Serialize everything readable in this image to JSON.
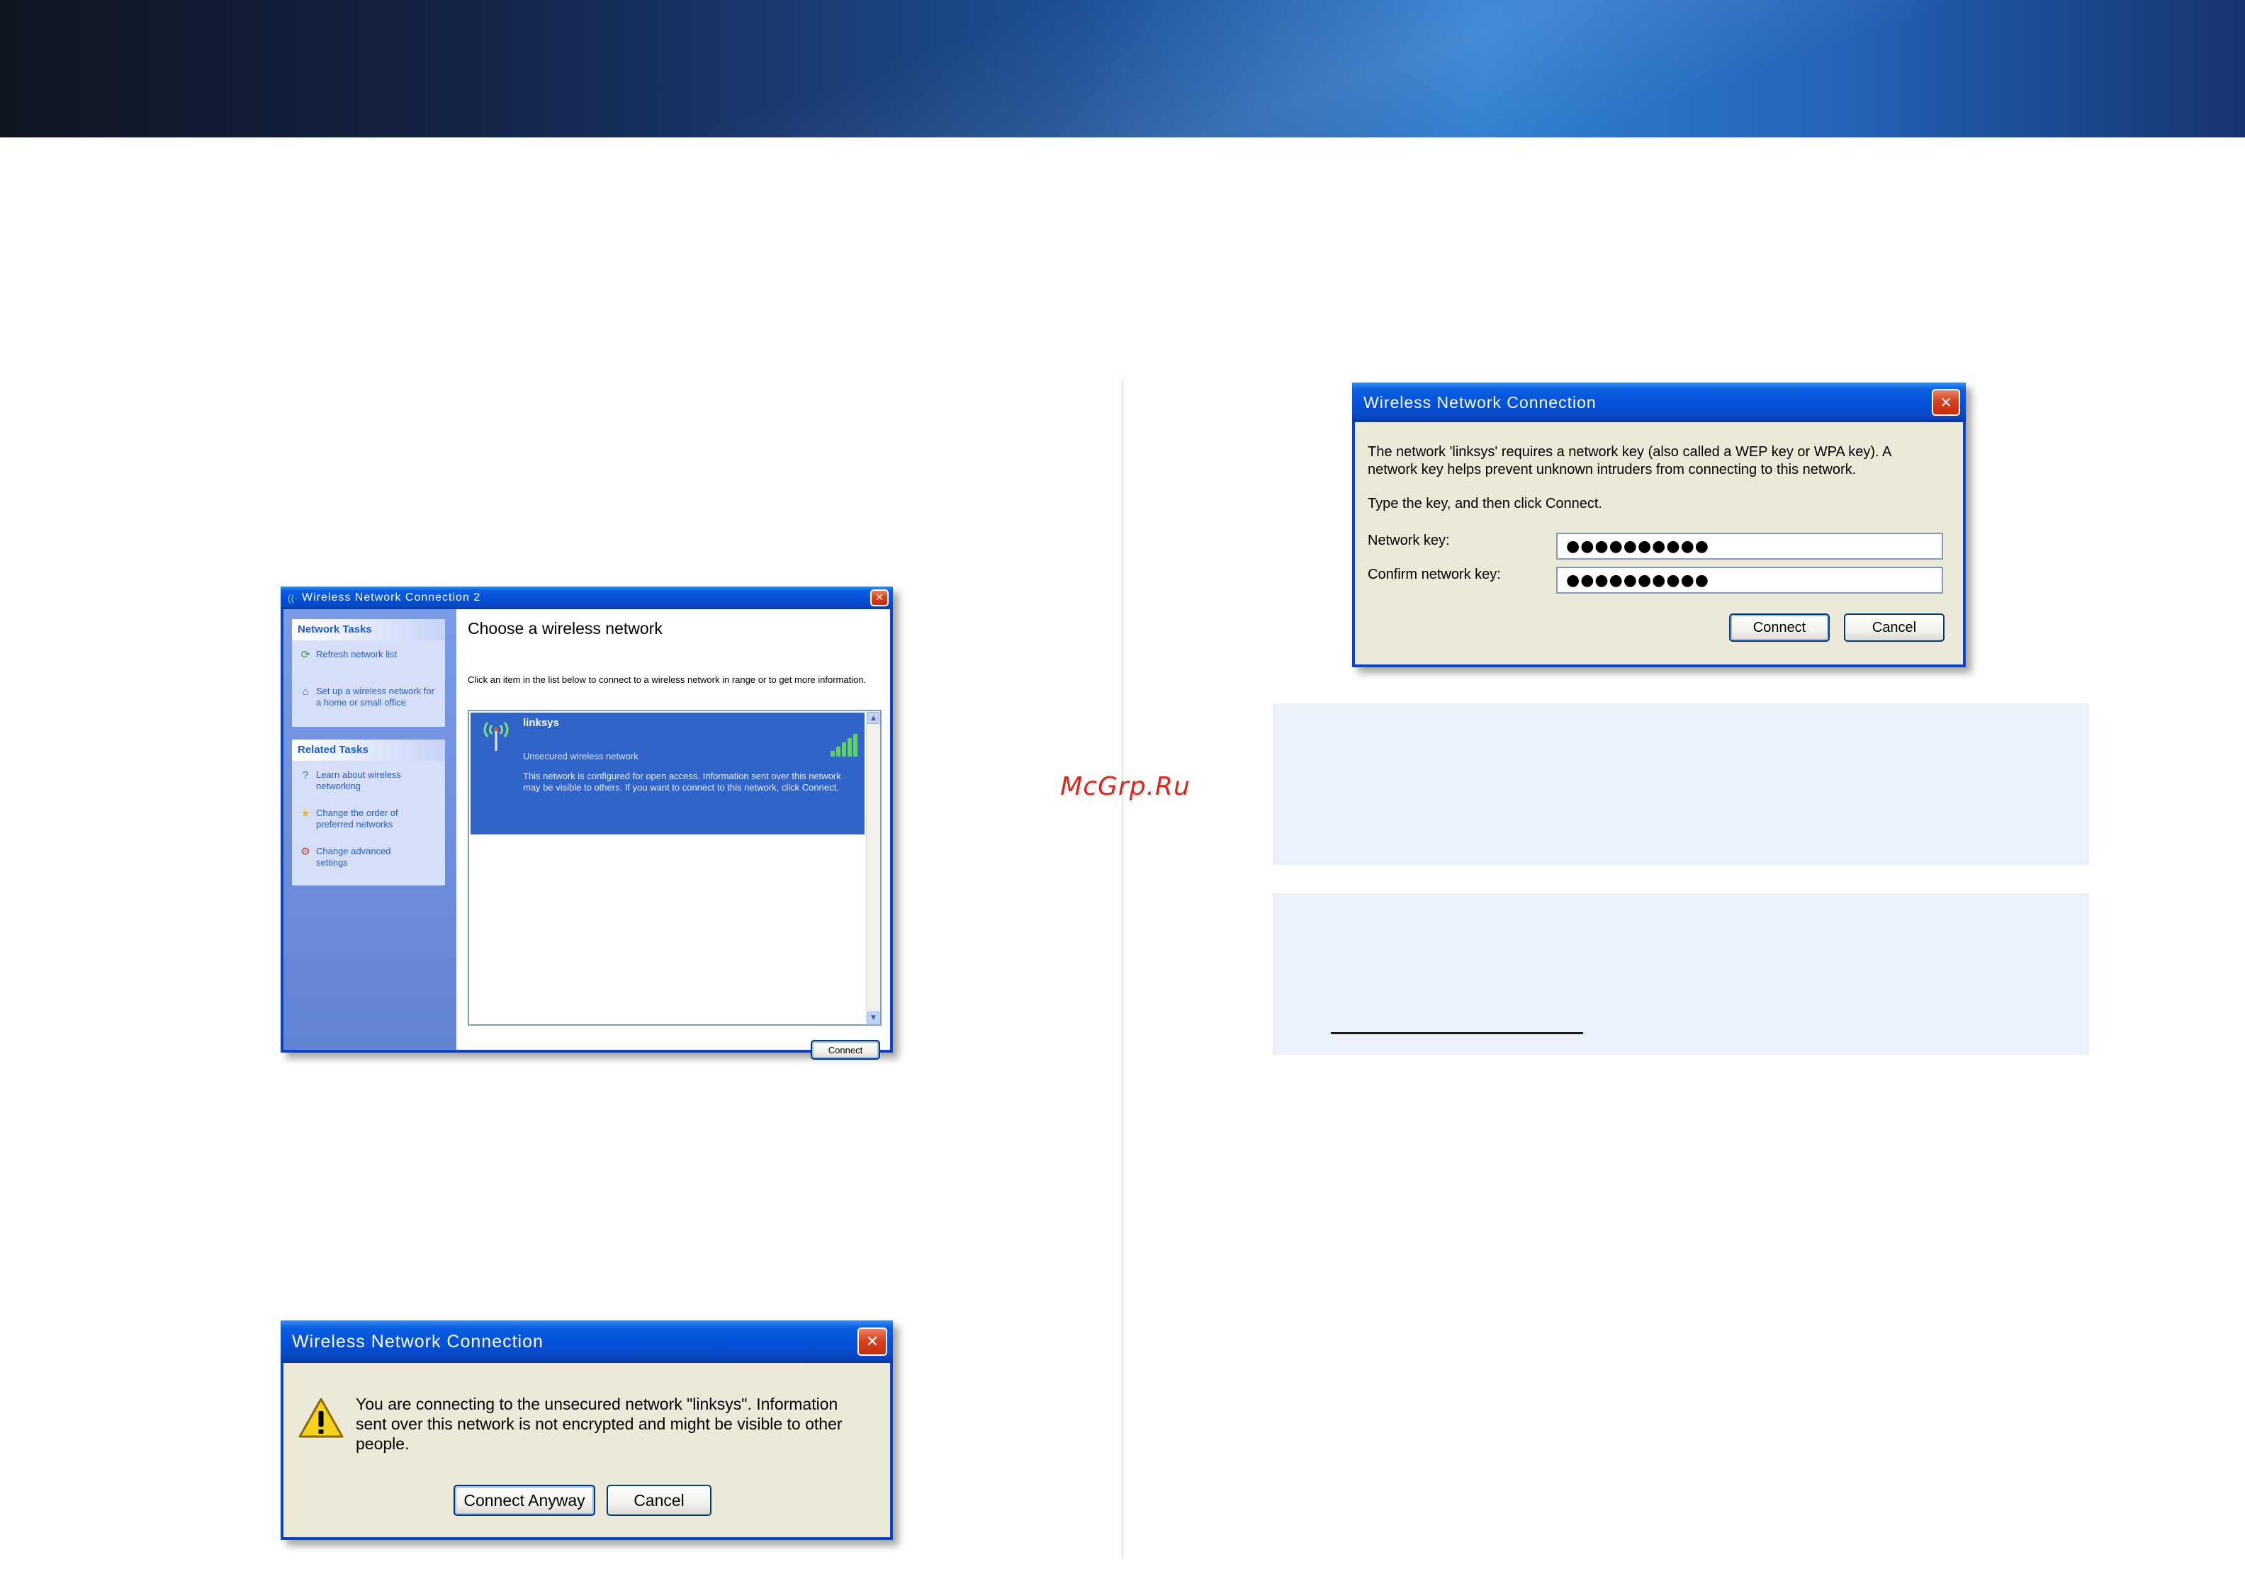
{
  "watermark": "McGrp.Ru",
  "choose_window": {
    "title": "Wireless Network Connection 2",
    "close_glyph": "✕",
    "network_tasks": {
      "header": "Network Tasks",
      "items": [
        {
          "label": "Refresh network list",
          "icon": "refresh-icon"
        },
        {
          "label": "Set up a wireless network for a home or small office",
          "icon": "setup-network-icon"
        }
      ]
    },
    "related_tasks": {
      "header": "Related Tasks",
      "items": [
        {
          "label": "Learn about wireless networking",
          "icon": "learn-icon"
        },
        {
          "label": "Change the order of preferred networks",
          "icon": "star-icon"
        },
        {
          "label": "Change advanced settings",
          "icon": "advanced-settings-icon"
        }
      ]
    },
    "heading": "Choose a wireless network",
    "instruction": "Click an item in the list below to connect to a wireless network in range or to get more information.",
    "network": {
      "name": "linksys",
      "status": "Unsecured wireless network",
      "description": "This network is configured for open access. Information sent over this network may be visible to others. If you want to connect to this network, click Connect."
    },
    "connect_label": "Connect"
  },
  "warning_window": {
    "title": "Wireless Network Connection",
    "close_glyph": "✕",
    "message": "You are connecting to the unsecured network \"linksys\". Information sent over this network is not encrypted and might be visible to other people.",
    "connect_anyway_label": "Connect Anyway",
    "cancel_label": "Cancel"
  },
  "key_window": {
    "title": "Wireless Network Connection",
    "close_glyph": "✕",
    "message": "The network 'linksys' requires a network key (also called a WEP key or WPA key). A network key helps prevent unknown intruders from connecting to this network.",
    "instruction": "Type the key, and then click Connect.",
    "network_key_label": "Network key:",
    "network_key_value": "●●●●●●●●●●",
    "confirm_key_label": "Confirm network key:",
    "confirm_key_value": "●●●●●●●●●●",
    "connect_label": "Connect",
    "cancel_label": "Cancel"
  },
  "colors": {
    "xp_title_blue": "#0550d8",
    "selection_blue": "#3164c8",
    "note_background": "#eaf1fb",
    "watermark_red": "#e0231b"
  }
}
